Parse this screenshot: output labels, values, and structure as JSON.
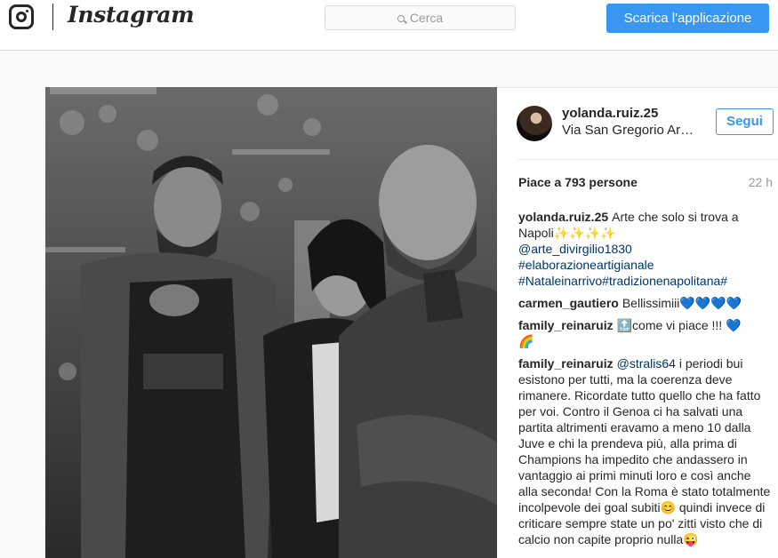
{
  "header": {
    "wordmark": "Instagram",
    "search_placeholder": "Cerca",
    "download_label": "Scarica l'applicazione",
    "accent_color": "#3897f0"
  },
  "post": {
    "author": "yolanda.ruiz.25",
    "location": "Via San Gregorio Armeno",
    "follow_label": "Segui",
    "likes": "Piace a 793 persone",
    "age": "22 h",
    "caption": {
      "user": "yolanda.ruiz.25",
      "text": "Arte che solo si trova a Napoli",
      "sparkles": "✨✨✨✨",
      "mention": "@arte_divirgilio1830",
      "hashtags": "#elaborazioneartigianale #Nataleinarrivo#tradizionenapolitana#"
    },
    "comments": [
      {
        "user": "carmen_gautiero",
        "text": "Bellissimiii",
        "hearts": "💙💙💙💙"
      },
      {
        "user": "family_reinaruiz",
        "badge": "🔝",
        "text": "come vi piace !!!",
        "heart": "💙",
        "rainbow": "🌈"
      },
      {
        "user": "family_reinaruiz",
        "mention": "@stralis64",
        "text": "i periodi bui esistono per tutti, ma la coerenza deve rimanere. Ricordate tutto quello che ha fatto per voi. Contro il Genoa ci ha salvati una partita altrimenti eravamo a meno 10 dalla Juve e chi la prendeva più, alla prima di Champions ha impedito che andassero in vantaggio ai primi minuti loro e così anche alla seconda! Con la Roma è stato totalmente incolpevole dei goal subiti",
        "smile": "😊",
        "text2": "quindi invece di criticare sempre state un po' zitti visto che di calcio non capite proprio nulla",
        "wink": "😜"
      }
    ]
  }
}
